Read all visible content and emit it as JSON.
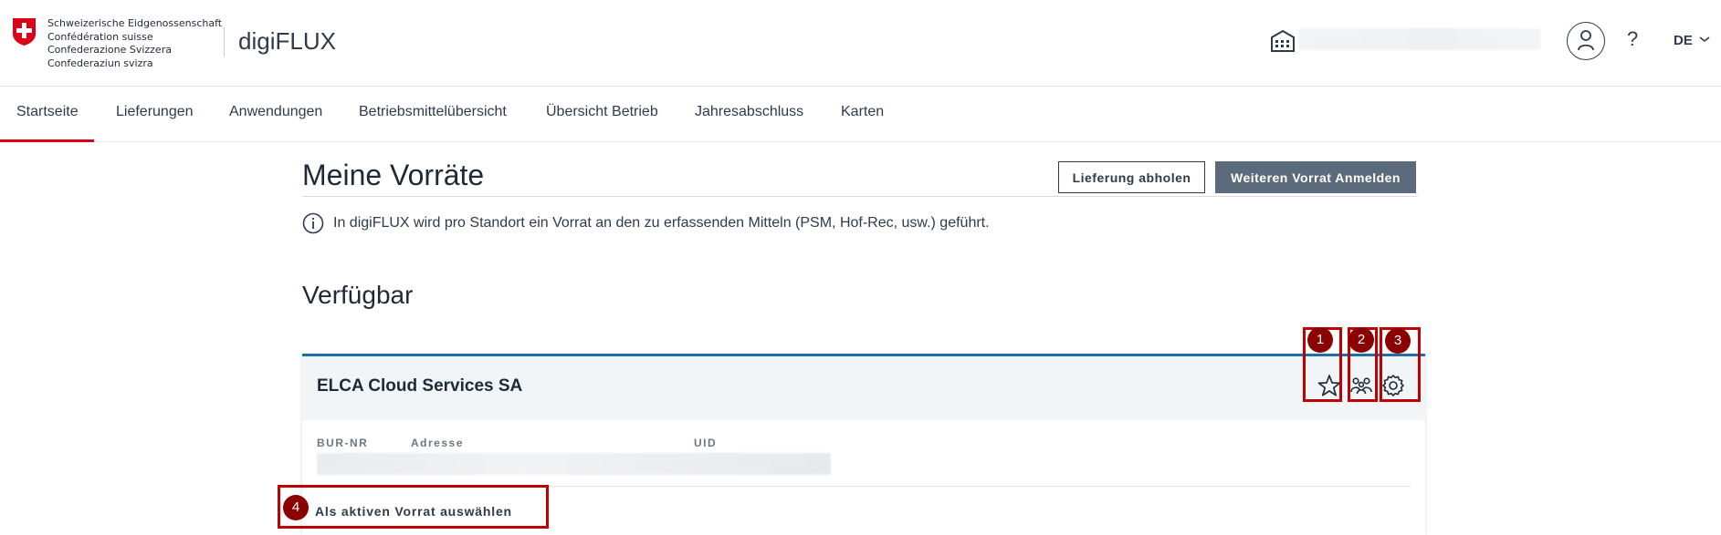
{
  "header": {
    "confederation_lines": [
      "Schweizerische Eidgenossenschaft",
      "Confédération suisse",
      "Confederazione Svizzera",
      "Confederaziun svizra"
    ],
    "app_name": "digiFLUX",
    "help_label": "?",
    "language": "DE"
  },
  "nav": {
    "items": [
      {
        "label": "Startseite",
        "active": true
      },
      {
        "label": "Lieferungen",
        "active": false
      },
      {
        "label": "Anwendungen",
        "active": false
      },
      {
        "label": "Betriebsmittelübersicht",
        "active": false
      },
      {
        "label": "Übersicht Betrieb",
        "active": false
      },
      {
        "label": "Jahresabschluss",
        "active": false
      },
      {
        "label": "Karten",
        "active": false
      }
    ]
  },
  "main": {
    "title": "Meine Vorräte",
    "btn_pickup": "Lieferung abholen",
    "btn_register": "Weiteren Vorrat Anmelden",
    "info_text": "In digiFLUX wird pro Standort ein Vorrat an den zu erfassenden Mitteln (PSM, Hof-Rec, usw.) geführt.",
    "section_title": "Verfügbar"
  },
  "card": {
    "title": "ELCA Cloud Services SA",
    "labels": [
      "BUR-NR",
      "Adresse",
      "UID"
    ],
    "select_action": "Als aktiven Vorrat auswählen"
  },
  "annotations": [
    "1",
    "2",
    "3",
    "4"
  ],
  "colors": {
    "swiss_red": "#dc0018",
    "card_accent": "#1e6ea8",
    "annotation_red": "#c00000",
    "badge_red": "#8b0000",
    "primary_button": "#5b6b7c"
  }
}
